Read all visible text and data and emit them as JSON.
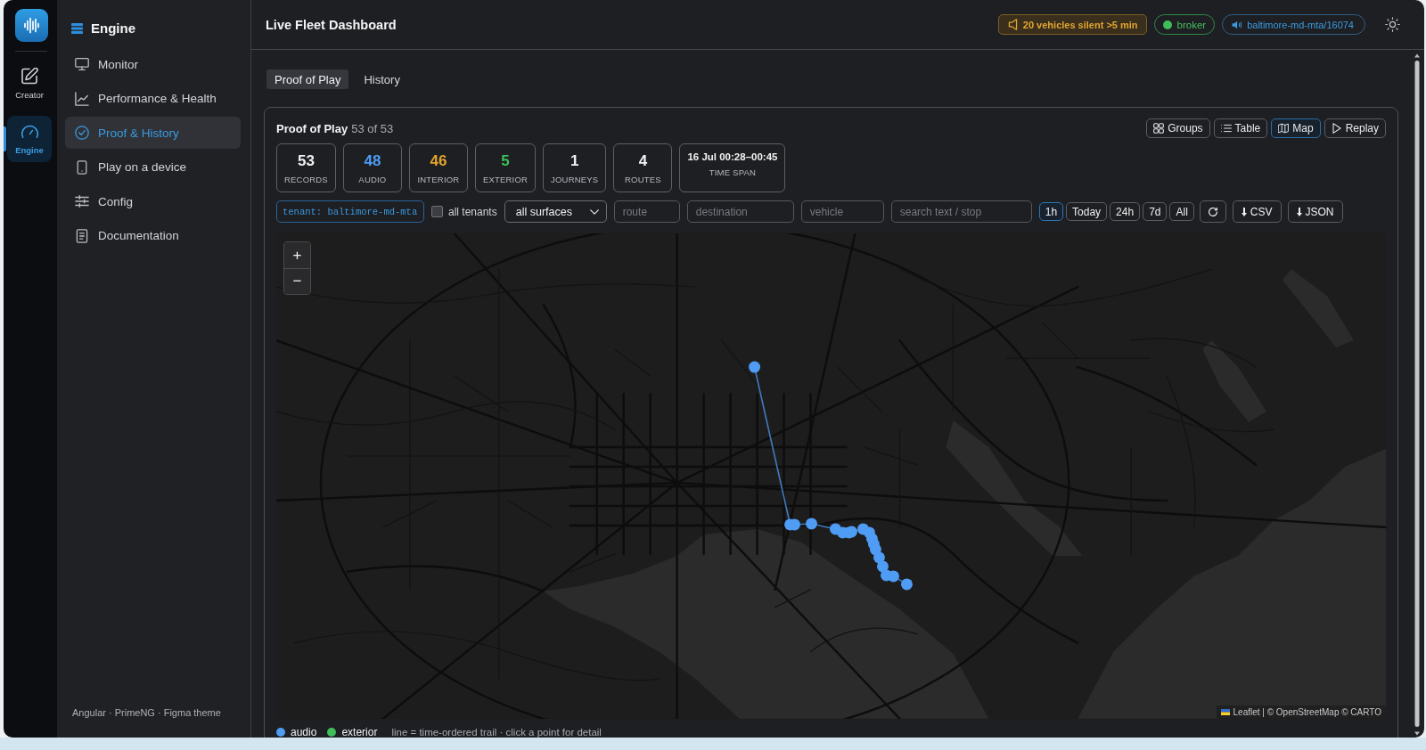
{
  "rail": {
    "items": [
      {
        "label": "Creator",
        "selected": false
      },
      {
        "label": "Engine",
        "selected": true
      }
    ]
  },
  "sidebar": {
    "title": "Engine",
    "items": [
      {
        "label": "Monitor",
        "selected": false
      },
      {
        "label": "Performance & Health",
        "selected": false
      },
      {
        "label": "Proof & History",
        "selected": true
      },
      {
        "label": "Play on a device",
        "selected": false
      },
      {
        "label": "Config",
        "selected": false
      },
      {
        "label": "Documentation",
        "selected": false
      }
    ],
    "footer": "Angular · PrimeNG · Figma theme"
  },
  "header": {
    "title": "Live Fleet Dashboard",
    "badges": [
      {
        "kind": "warning",
        "text": "20 vehicles silent >5 min"
      },
      {
        "kind": "status",
        "text": "broker"
      },
      {
        "kind": "tenant",
        "text": "baltimore-md-mta/16074"
      }
    ]
  },
  "tabs": [
    {
      "label": "Proof of Play",
      "selected": true
    },
    {
      "label": "History",
      "selected": false
    }
  ],
  "panel": {
    "title": "Proof of Play",
    "count": "53 of 53",
    "views": [
      {
        "label": "Groups",
        "selected": false
      },
      {
        "label": "Table",
        "selected": false
      },
      {
        "label": "Map",
        "selected": true
      },
      {
        "label": "Replay",
        "selected": false
      }
    ],
    "stats": [
      {
        "kind": "count",
        "value": "53",
        "label": "RECORDS",
        "color": "#f2f2f2"
      },
      {
        "kind": "count",
        "value": "48",
        "label": "AUDIO",
        "color": "#4f9cf5"
      },
      {
        "kind": "count",
        "value": "46",
        "label": "INTERIOR",
        "color": "#e3a42b"
      },
      {
        "kind": "count",
        "value": "5",
        "label": "EXTERIOR",
        "color": "#3fbf5a"
      },
      {
        "kind": "count",
        "value": "1",
        "label": "JOURNEYS",
        "color": "#f2f2f2"
      },
      {
        "kind": "count",
        "value": "4",
        "label": "ROUTES",
        "color": "#f2f2f2"
      },
      {
        "kind": "span",
        "value": "16 Jul 00:28–00:45",
        "label": "TIME SPAN",
        "color": "#f2f2f2"
      }
    ]
  },
  "filters": {
    "tenant": "tenant: baltimore-md-mta",
    "all_tenants": {
      "label": "all tenants",
      "checked": false
    },
    "surface": "all surfaces",
    "fields": [
      {
        "placeholder": "route"
      },
      {
        "placeholder": "destination"
      },
      {
        "placeholder": "vehicle"
      },
      {
        "placeholder": "search text / stop"
      }
    ],
    "ranges": [
      {
        "label": "1h",
        "selected": true
      },
      {
        "label": "Today",
        "selected": false
      },
      {
        "label": "24h",
        "selected": false
      },
      {
        "label": "7d",
        "selected": false
      },
      {
        "label": "All",
        "selected": false
      }
    ],
    "exports": [
      "CSV",
      "JSON"
    ]
  },
  "map": {
    "zoom_in": "+",
    "zoom_out": "−",
    "attribution": "Leaflet | © OpenStreetMap © CARTO",
    "legend": [
      {
        "label": "audio",
        "color": "#4f9cf5"
      },
      {
        "label": "exterior",
        "color": "#3fbf5a"
      }
    ],
    "note": "line = time-ordered trail · click a point for detail"
  }
}
